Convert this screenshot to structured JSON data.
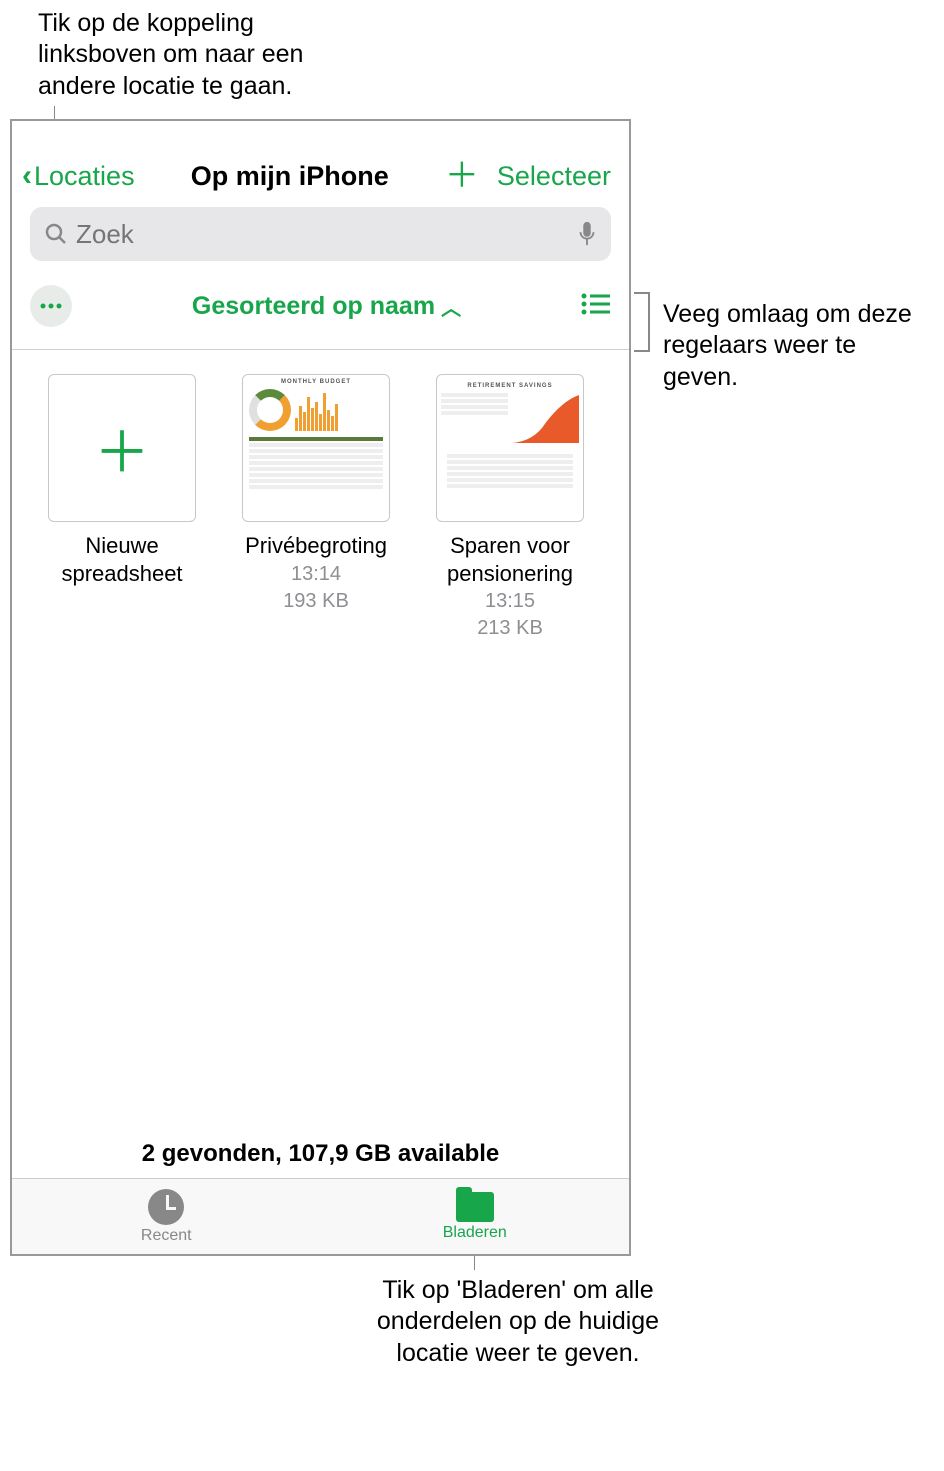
{
  "callouts": {
    "top": "Tik op de koppeling linksboven om naar een andere locatie te gaan.",
    "right": "Veeg omlaag om deze regelaars weer te geven.",
    "bottom": "Tik op 'Bladeren' om alle onderdelen op de huidige locatie weer te geven."
  },
  "navbar": {
    "back_label": "Locaties",
    "title": "Op mijn iPhone",
    "select_label": "Selecteer"
  },
  "search": {
    "placeholder": "Zoek"
  },
  "sort": {
    "label": "Gesorteerd op naam"
  },
  "files": {
    "new_label": "Nieuwe spreadsheet",
    "items": [
      {
        "label": "Privébegroting",
        "time": "13:14",
        "size": "193 KB",
        "doc_title": "MONTHLY BUDGET"
      },
      {
        "label": "Sparen voor pensionering",
        "time": "13:15",
        "size": "213 KB",
        "doc_title": "RETIREMENT SAVINGS"
      }
    ]
  },
  "footer": {
    "storage": "2 gevonden, 107,9 GB available"
  },
  "tabs": {
    "recent": "Recent",
    "browse": "Bladeren"
  }
}
